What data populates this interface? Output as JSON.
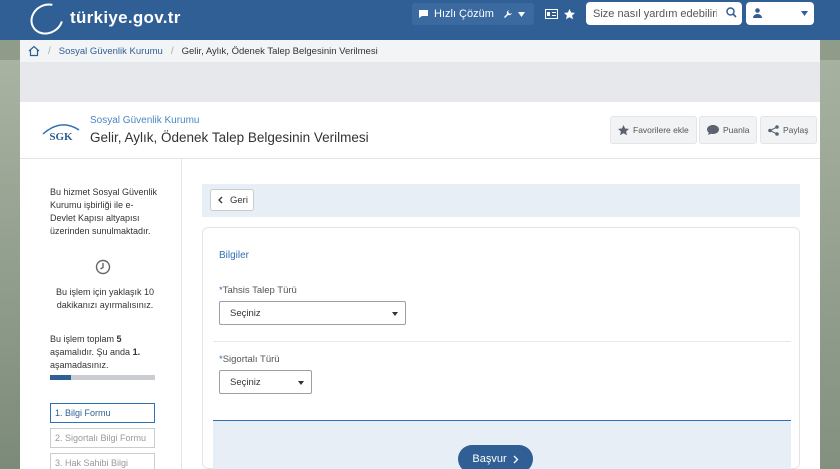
{
  "header": {
    "logo_text": "türkiye.gov.tr",
    "quick_solution_label": "Hızlı Çözüm",
    "search_placeholder": "Size nasıl yardım edebilirim?"
  },
  "breadcrumb": {
    "items": [
      "Sosyal Güvenlik Kurumu",
      "Gelir, Aylık, Ödenek Talep Belgesinin Verilmesi"
    ]
  },
  "service": {
    "org_name": "Sosyal Güvenlik Kurumu",
    "title": "Gelir, Aylık, Ödenek Talep Belgesinin Verilmesi",
    "logo_text": "SGK",
    "actions": {
      "favorite": "Favorilere ekle",
      "rate": "Puanla",
      "share": "Paylaş"
    }
  },
  "sidebar": {
    "info_lines": [
      "Bu hizmet Sosyal Güvenlik",
      "Kurumu işbirliği ile e-",
      "Devlet Kapısı altyapısı",
      "üzerinden sunulmaktadır."
    ],
    "time_lines": [
      "Bu işlem için yaklaşık 10",
      "dakikanızı ayırmalısınız."
    ],
    "progress_lines_1": [
      "Bu işlem toplam ",
      "5",
      ""
    ],
    "progress_text": {
      "line1_a": "Bu işlem toplam ",
      "line1_b": "5",
      "line2_a": "aşamalıdır. Şu anda ",
      "line2_b": "1.",
      "line3": "aşamadasınız."
    },
    "progress_fraction": 0.2,
    "steps": [
      "1. Bilgi Formu",
      "2. Sigortalı Bilgi Formu",
      "3. Hak Sahibi Bilgi"
    ]
  },
  "content": {
    "back_label": "Geri",
    "section_title": "Bilgiler",
    "required_mark": "*",
    "fields": [
      {
        "label": "Tahsis Talep Türü",
        "value": "Seçiniz"
      },
      {
        "label": "Sigortalı Türü",
        "value": "Seçiniz"
      }
    ],
    "submit_label": "Başvur"
  },
  "colors": {
    "brand_blue": "#2f5f94",
    "accent_blue": "#2f6fb4"
  }
}
